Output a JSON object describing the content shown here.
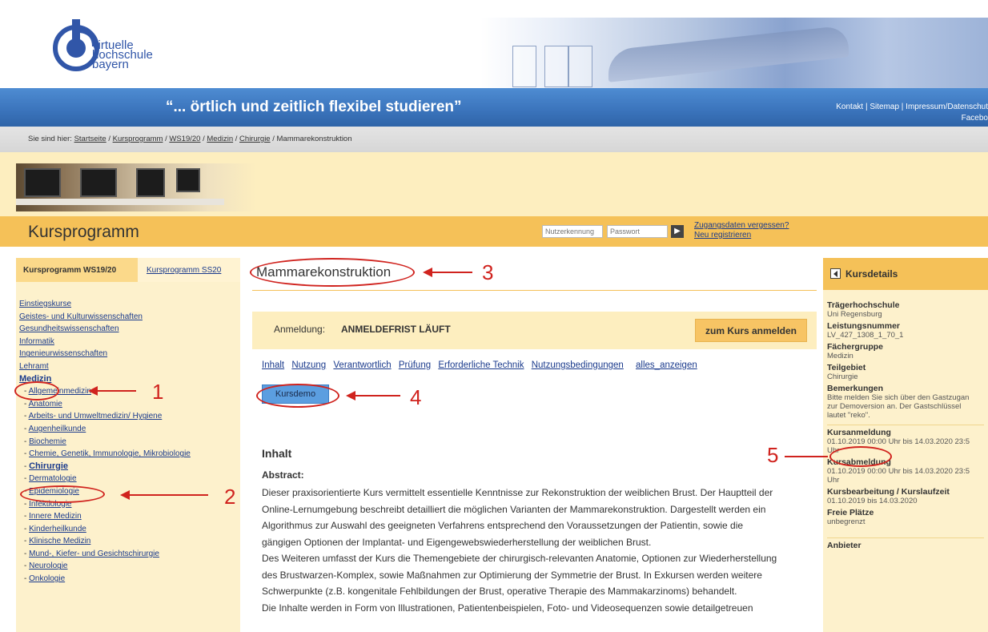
{
  "header": {
    "logo_lines": [
      "virtuelle",
      "hochschule",
      "bayern"
    ],
    "slogan": "“... örtlich und zeitlich flexibel studieren”",
    "toplinks": "Kontakt | Sitemap | Impressum/Datenschut",
    "facebook": "Facebo"
  },
  "breadcrumb": {
    "prefix": "Sie sind hier:",
    "items": [
      "Startseite",
      "Kursprogramm",
      "WS19/20",
      "Medizin",
      "Chirurgie"
    ],
    "current": "Mammarekonstruktion"
  },
  "kursprogramm": {
    "title": "Kursprogramm",
    "user_placeholder": "Nutzerkennung",
    "pass_placeholder": "Passwort",
    "go_label": "▶",
    "forgot": "Zugangsdaten vergessen?",
    "register": "Neu registrieren"
  },
  "sidebar": {
    "tab_active": "Kursprogramm WS19/20",
    "tab_other": "Kursprogramm SS20",
    "categories": [
      "Einstiegskurse",
      "Geistes- und Kulturwissenschaften",
      "Gesundheitswissenschaften",
      "Informatik",
      "Ingenieurwissenschaften",
      "Lehramt"
    ],
    "active_category": "Medizin",
    "subcategories": [
      "Allgemeinmedizin",
      "Anatomie",
      "Arbeits- und Umweltmedizin/ Hygiene",
      "Augenheilkunde",
      "Biochemie",
      "Chemie, Genetik, Immunologie, Mikrobiologie",
      "Chirurgie",
      "Dermatologie",
      "Epidemiologie",
      "Infektiologie",
      "Innere Medizin",
      "Kinderheilkunde",
      "Klinische Medizin",
      "Mund-, Kiefer- und Gesichtschirurgie",
      "Neurologie",
      "Onkologie"
    ],
    "active_subcategory": "Chirurgie"
  },
  "main": {
    "title": "Mammarekonstruktion",
    "anmeldung_label": "Anmeldung:",
    "anmeldung_status": "ANMELDEFRIST LÄUFT",
    "anmeldung_button": "zum Kurs anmelden",
    "tabs": [
      "Inhalt",
      "Nutzung",
      "Verantwortlich",
      "Prüfung",
      "Erforderliche Technik",
      "Nutzungsbedingungen",
      "alles_anzeigen"
    ],
    "demo_button": "Kursdemo",
    "inhalt_heading": "Inhalt",
    "abstract_heading": "Abstract:",
    "abstract_lines": [
      "Dieser praxisorientierte Kurs vermittelt essentielle Kenntnisse zur Rekonstruktion der weiblichen Brust. Der Hauptteil der",
      "Online-Lernumgebung beschreibt detailliert die möglichen Varianten der Mammarekonstruktion. Dargestellt werden ein",
      "Algorithmus zur Auswahl des geeigneten Verfahrens entsprechend den Voraussetzungen der Patientin, sowie die",
      "gängigen Optionen der Implantat- und Eigengewebswiederherstellung der weiblichen Brust.",
      "Des Weiteren umfasst der Kurs die Themengebiete der chirurgisch-relevanten Anatomie, Optionen zur Wiederherstellung",
      "des Brustwarzen-Komplex, sowie Maßnahmen zur Optimierung der Symmetrie der Brust. In Exkursen werden weitere",
      "Schwerpunkte (z.B. kongenitale Fehlbildungen der Brust, operative Therapie des Mammakarzinoms) behandelt.",
      "Die Inhalte werden in Form von Illustrationen, Patientenbeispielen, Foto- und Videosequenzen sowie detailgetreuen"
    ]
  },
  "details": {
    "title": "Kursdetails",
    "traeger_label": "Trägerhochschule",
    "traeger_value": "Uni Regensburg",
    "leistung_label": "Leistungsnummer",
    "leistung_value": "LV_427_1308_1_70_1",
    "faecher_label": "Fächergruppe",
    "faecher_value": "Medizin",
    "teil_label": "Teilgebiet",
    "teil_value": "Chirurgie",
    "bem_label": "Bemerkungen",
    "bem_lines": [
      "Bitte melden Sie sich über den Gastzugan",
      "zur Demoversion an. Der Gastschlüssel",
      "lautet \"reko\"."
    ],
    "anm_label": "Kursanmeldung",
    "anm_lines": [
      "01.10.2019 00:00 Uhr bis 14.03.2020 23:5",
      "Uhr"
    ],
    "abm_label": "Kursabmeldung",
    "abm_lines": [
      "01.10.2019 00:00 Uhr bis 14.03.2020 23:5",
      "Uhr"
    ],
    "laufzeit_label": "Kursbearbeitung / Kurslaufzeit",
    "laufzeit_value": "01.10.2019 bis 14.03.2020",
    "plaetze_label": "Freie Plätze",
    "plaetze_value": "unbegrenzt",
    "anbieter_label": "Anbieter"
  },
  "annotations": {
    "n1": "1",
    "n2": "2",
    "n3": "3",
    "n4": "4",
    "n5": "5"
  },
  "colors": {
    "header_blue": "#3a73bb",
    "accent_orange": "#f5c158",
    "light_yellow": "#fdf1cc",
    "annotation_red": "#d0231e",
    "demo_blue": "#5b9ee0"
  }
}
